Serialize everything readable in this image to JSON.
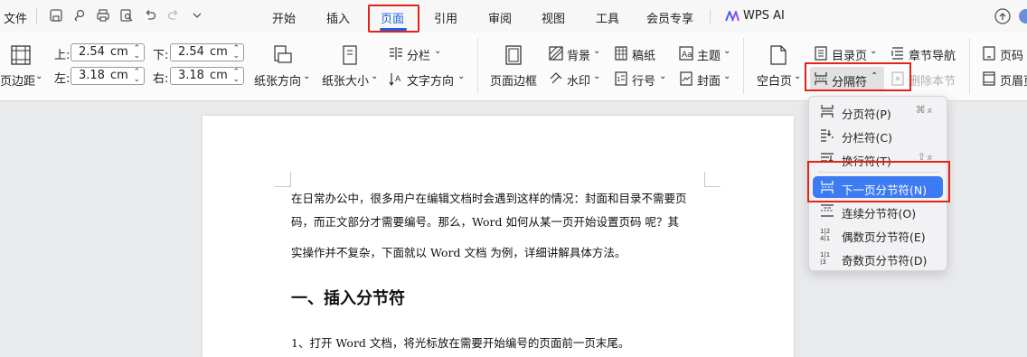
{
  "menubar": {
    "file": "文件",
    "tabs": [
      "开始",
      "插入",
      "页面",
      "引用",
      "审阅",
      "视图",
      "工具",
      "会员专享"
    ],
    "active_tab": "页面",
    "ai": "WPS AI"
  },
  "ribbon": {
    "margins_label": "页边距",
    "top_label": "上:",
    "top_value": "2.54",
    "bottom_label": "下:",
    "bottom_value": "2.54",
    "left_label": "左:",
    "left_value": "3.18",
    "right_label": "右:",
    "right_value": "3.18",
    "unit": "cm",
    "orientation": "纸张方向",
    "size": "纸张大小",
    "columns": "分栏",
    "text_direction": "文字方向",
    "page_border": "页面边框",
    "background": "背景",
    "watermark": "水印",
    "manuscript": "稿纸",
    "line_number": "行号",
    "theme": "主题",
    "cover": "封面",
    "blank_page": "空白页",
    "toc_page": "目录页",
    "break": "分隔符",
    "chapter_nav": "章节导航",
    "delete_section": "删除本节",
    "page_number": "页码",
    "header_footer": "页眉页"
  },
  "dropdown": {
    "items": [
      {
        "label": "分页符(P)",
        "shortcut": "⌘⌅"
      },
      {
        "label": "分栏符(C)",
        "shortcut": ""
      },
      {
        "label": "换行符(T)",
        "shortcut": "⇧⌅"
      },
      {
        "label": "下一页分节符(N)",
        "shortcut": ""
      },
      {
        "label": "连续分节符(O)",
        "shortcut": ""
      },
      {
        "label": "偶数页分节符(E)",
        "shortcut": ""
      },
      {
        "label": "奇数页分节符(D)",
        "shortcut": ""
      }
    ]
  },
  "document": {
    "line1": "在日常办公中，很多用户在编辑文档时会遇到这样的情况：封面和目录不需要页",
    "line2": "码，而正文部分才需要编号。那么，Word 如何从某一页开始设置页码 呢？其",
    "line3": "实操作并不复杂，下面就以 Word 文档 为例，详细讲解具体方法。",
    "heading": "一、插入分节符",
    "step1": "1、打开  Word 文档，将光标放在需要开始编号的页面前一页末尾。"
  },
  "colors": {
    "accent": "#1f5ee6",
    "highlight": "#e2231a",
    "selected": "#3d7bf2"
  }
}
